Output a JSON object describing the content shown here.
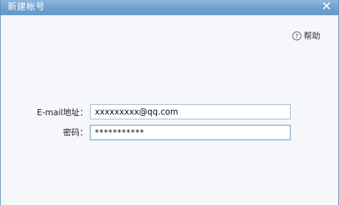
{
  "window": {
    "title": "新建帐号",
    "close_icon": "close-icon"
  },
  "help": {
    "icon": "help-circle-icon",
    "label": "帮助"
  },
  "form": {
    "email": {
      "label": "E-mail地址：",
      "value": "xxxxxxxxx@qq.com"
    },
    "password": {
      "label": "密码：",
      "value": "***********"
    }
  },
  "colors": {
    "titlebar": "#7aa8d4",
    "background": "#f5f7fa",
    "focus_border": "#6fa3cf"
  }
}
